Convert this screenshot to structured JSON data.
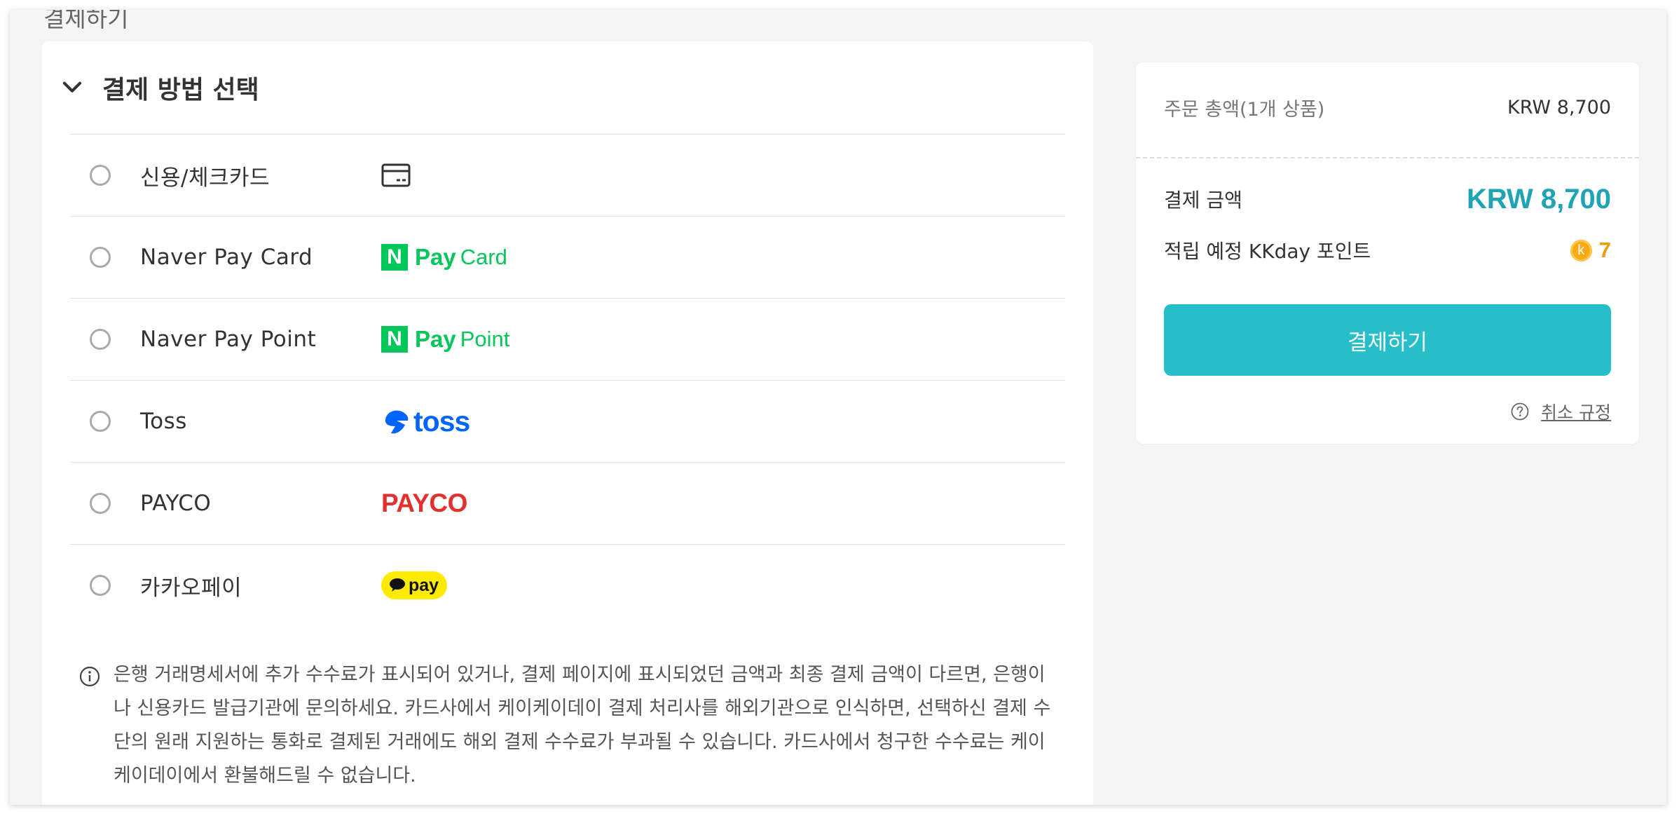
{
  "page": {
    "heading": "결제하기"
  },
  "payment_section": {
    "title": "결제 방법 선택",
    "methods": [
      {
        "label": "신용/체크카드",
        "logo": "card-icon"
      },
      {
        "label": "Naver Pay Card",
        "logo_text": "Pay",
        "logo_sub": "Card",
        "logo_mark": "N"
      },
      {
        "label": "Naver Pay Point",
        "logo_text": "Pay",
        "logo_sub": "Point",
        "logo_mark": "N"
      },
      {
        "label": "Toss",
        "logo_text": "toss"
      },
      {
        "label": "PAYCO",
        "logo_text": "PAYCO"
      },
      {
        "label": "카카오페이",
        "logo_text": "pay"
      }
    ],
    "notice": "은행 거래명세서에 추가 수수료가 표시되어 있거나, 결제 페이지에 표시되었던 금액과 최종 결제 금액이 다르면, 은행이나 신용카드 발급기관에 문의하세요. 카드사에서 케이케이데이 결제 처리사를 해외기관으로 인식하면, 선택하신 결제 수단의 원래 지원하는 통화로 결제된 거래에도 해외 결제 수수료가 부과될 수 있습니다. 카드사에서 청구한 수수료는 케이케이데이에서 환불해드릴 수 없습니다."
  },
  "summary": {
    "order_total_label": "주문 총액(1개 상품)",
    "order_total_value": "KRW 8,700",
    "pay_amount_label": "결제 금액",
    "pay_amount_value": "KRW 8,700",
    "points_label": "적립 예정 KKday 포인트",
    "points_coin": "k",
    "points_value": "7",
    "pay_button": "결제하기",
    "cancel_policy": "취소 규정"
  },
  "colors": {
    "accent": "#26bec9",
    "amount": "#1fa3b5",
    "naver_green": "#03c75a",
    "toss_blue": "#0064ff",
    "payco_red": "#e0312d",
    "kakao_yellow": "#ffeb00",
    "points_orange": "#f29b00"
  }
}
